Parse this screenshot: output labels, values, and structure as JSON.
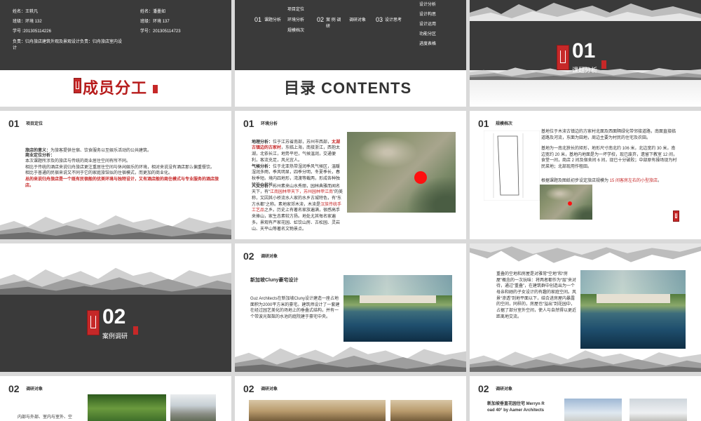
{
  "slide1": {
    "name1": "姓名：王轶凡",
    "class1": "班级：环境 132",
    "id1": "学号 :201305114226",
    "name2": "姓名：潘墨如",
    "class2": "班级：环境 137",
    "id2": "学号：201305114723",
    "duty": "负责：归舟旅店建筑外观及景观设计负责：归舟旅店室内设\n计",
    "title": "成员分工"
  },
  "slide2": {
    "col1_num": "01",
    "col1_label": "课题分析",
    "col1_items": [
      "项目定位",
      "环境分析",
      "规模档次"
    ],
    "col2_num": "02",
    "col2_label": "案 例 调\n研",
    "col2_items": [
      "调研对象"
    ],
    "col3_num": "03",
    "col3_label": "设计思考",
    "col3_items": [
      "设计分析",
      "设计构思",
      "设计运用",
      "功能分区",
      "进度表格"
    ],
    "title": "目录 CONTENTS"
  },
  "slide3": {
    "num": "01",
    "label": "课题分析"
  },
  "slide4": {
    "num": "01",
    "title": "项目定位",
    "p1_bold": "旅店的意义：",
    "p1": "为旅客提供住宿、饮食服务以至娱乐活动的公共建筑。",
    "p2_bold": "商业定位分析：",
    "p2": "本次课题所涉及的旅店与传统的商业居住空间有所不同。\n相比于传统的酒店来说归舟旅店更注重居住空间与休闲娱乐的环境，相对来说没有酒店那么偏重餐饮。\n相比于普通的民宿来说又不同于它的家庭旅馆似的住宿模式，而更加的商业化。",
    "p3": "总的来说归舟旅店是一个既有民宿般的优美环境与独特设计，又有酒店般的商住模式与专业服务的酒店旅店。"
  },
  "slide5": {
    "num": "01",
    "title": "环境分析",
    "geo_bold": "地理分析：",
    "geo": "位于江苏省南部，苏州市西部，",
    "geo_red": "太湖古镇边的古家村",
    "geo2": "，东临上海，南接浙江，西抱太湖，北依长江，地势平坦，气候温润，交通便利，客流充足，风光宜人。",
    "climate_bold": "气候分析：",
    "climate": "位于北亚热带湿润季风气候区，温暖湿润多雨，季风明显，四季分明，冬夏季长，春秋季短。境内四地形，湾渡等截两，形成各种独特的小气候。",
    "culture_bold": "人文分析：",
    "culture": "苏州素来山水秀丽，园林典雅而闻名天下，有“",
    "culture_red": "江南园林甲天下，苏州园林甲江南",
    "culture2": "”的美称，又因其小桥流水人家的水乡古城特色，有“东方水都”之称。素地家郊木渎，木渎是",
    "culture_red2": "汉族传统手工艺品",
    "culture3": "之乡。历史上有著名家族遍满，很感高手来捧山，家生态素较方扬。地处尤其每名家遍多。景观有严家花园、虹饮山房、古松园、灵岩山、天平山等著名文物景点。"
  },
  "slide6": {
    "num": "01",
    "title": "规模档次",
    "p1": "基地位于木渎古镇边的方家村北面及西面隔绿化带邻接道路，南面直接临道路及河流，东面为田地，周边主要为村民的住宅及农田。",
    "p2": "基地为一南北狭长的矩形，地形尺寸南北约 106 米，北边宽约 30 米，南边宽约 20 米，基地内地面是为一坏学校，现已废弃，遗留下教室 12 间，食堂一间，商店 2 间及宿舍间 6 间，现已十分破败；中部原有操场现为村民菜地；北部现用作租田。",
    "p3a": "根据课题及图纸初步设定旅店规模为 ",
    "p3_red": "15 间客房左右的小型旅店",
    "p3b": "。"
  },
  "slide7": {
    "num": "02",
    "label": "案例调研"
  },
  "slide8": {
    "num": "02",
    "title": "调研对象",
    "case_title": "新加坡Cluny豪宅设计",
    "body": "Guz Architects在新加坡Cluny设计建造一座占地面积为2000平方米的豪宅。建筑师设计了一套建在经过园艺美化的场地上的垂叠式结构，并有一个带波光粼粼的水池的庭院建于豪宅中央。"
  },
  "slide9": {
    "body": "重叠的空地和房屋是对雅常“空地”和“房屋”概念的一次玩味：将两者都作为“层”来对待，通过“重叠”，在建筑群中创造出为一个母亲和她的子女设计的有趣的家庭空间。风景“渗透”到地平面以下，结合进房屋内暴露的空间，同样的，房屋也“溢出”到花园中，占据了部分室外空间，使人与自然得以更近距离地交流。"
  },
  "slide10": {
    "num": "02",
    "title": "调研对象",
    "body": "内部与外部、室内与室外、空"
  },
  "slide11": {
    "num": "02",
    "title": "调研对象"
  },
  "slide12": {
    "num": "02",
    "title": "调研对象",
    "case_title": "新加坡垂直花园住宅 Merryn R\noad 40° by Aamer Architects"
  },
  "colors": {
    "dark": "#3a3a3a",
    "accent_red": "#c62828"
  }
}
